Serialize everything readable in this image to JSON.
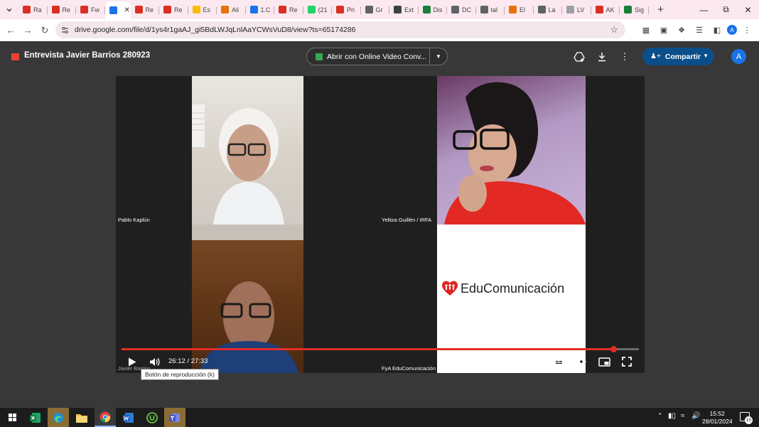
{
  "tabs": [
    {
      "label": "Ra",
      "icon": "heart-icon",
      "color": "#d93025"
    },
    {
      "label": "Re",
      "icon": "gmail-icon",
      "color": "#d93025"
    },
    {
      "label": "Fw",
      "icon": "gmail-icon",
      "color": "#d93025"
    },
    {
      "label": "",
      "icon": "drive-icon",
      "color": "#1a73e8",
      "active": true
    },
    {
      "label": "Re",
      "icon": "gmail-icon",
      "color": "#d93025"
    },
    {
      "label": "Re",
      "icon": "gmail-icon",
      "color": "#d93025"
    },
    {
      "label": "Es",
      "icon": "drive-icon",
      "color": "#fbbc04"
    },
    {
      "label": "Ali",
      "icon": "grid-icon",
      "color": "#e8710a"
    },
    {
      "label": "1.C",
      "icon": "drive-icon",
      "color": "#1a73e8"
    },
    {
      "label": "Re",
      "icon": "gmail-icon",
      "color": "#d93025"
    },
    {
      "label": "(21",
      "icon": "whatsapp-icon",
      "color": "#25d366"
    },
    {
      "label": "Pri",
      "icon": "g-icon",
      "color": "#d93025"
    },
    {
      "label": "Gr",
      "icon": "globe-icon",
      "color": "#5f6368"
    },
    {
      "label": "Ext",
      "icon": "square-icon",
      "color": "#3c4043"
    },
    {
      "label": "Dis",
      "icon": "plus-icon",
      "color": "#188038"
    },
    {
      "label": "DC",
      "icon": "globe-icon",
      "color": "#5f6368"
    },
    {
      "label": "tal",
      "icon": "globe-icon",
      "color": "#5f6368"
    },
    {
      "label": "El",
      "icon": "square-icon",
      "color": "#e8710a"
    },
    {
      "label": "La",
      "icon": "globe-icon",
      "color": "#5f6368"
    },
    {
      "label": "LV",
      "icon": "star-icon",
      "color": "#9aa0a6"
    },
    {
      "label": "AK",
      "icon": "heart-icon",
      "color": "#d93025"
    },
    {
      "label": "Sig",
      "icon": "bars-icon",
      "color": "#188038"
    }
  ],
  "address": {
    "url": "drive.google.com/file/d/1ys4r1gaAJ_gi5BdLWJqLnlAaYCWsVuD8/view?ts=65174286"
  },
  "drive": {
    "title": "Entrevista Javier Barrios 280923",
    "open_with": "Abrir con Online Video Conv...",
    "share": "Compartir",
    "account_initial": "A"
  },
  "video": {
    "participants": [
      "Pablo Kaplún",
      "Yelitza Guillén / IRFA",
      "Javier Barrios",
      "FyA EduComunicación"
    ],
    "logo_text": "EduComunicación",
    "time": "26:12 / 27:33",
    "progress": 0.951,
    "tooltip": "Botón de reproducción (k)"
  },
  "taskbar": {
    "time": "15:52",
    "date": "28/01/2024",
    "notifications": "10"
  },
  "colors": {
    "tabstrip": "#fbe9ef",
    "progress": "#e52d27",
    "share": "#0b4f8a"
  }
}
